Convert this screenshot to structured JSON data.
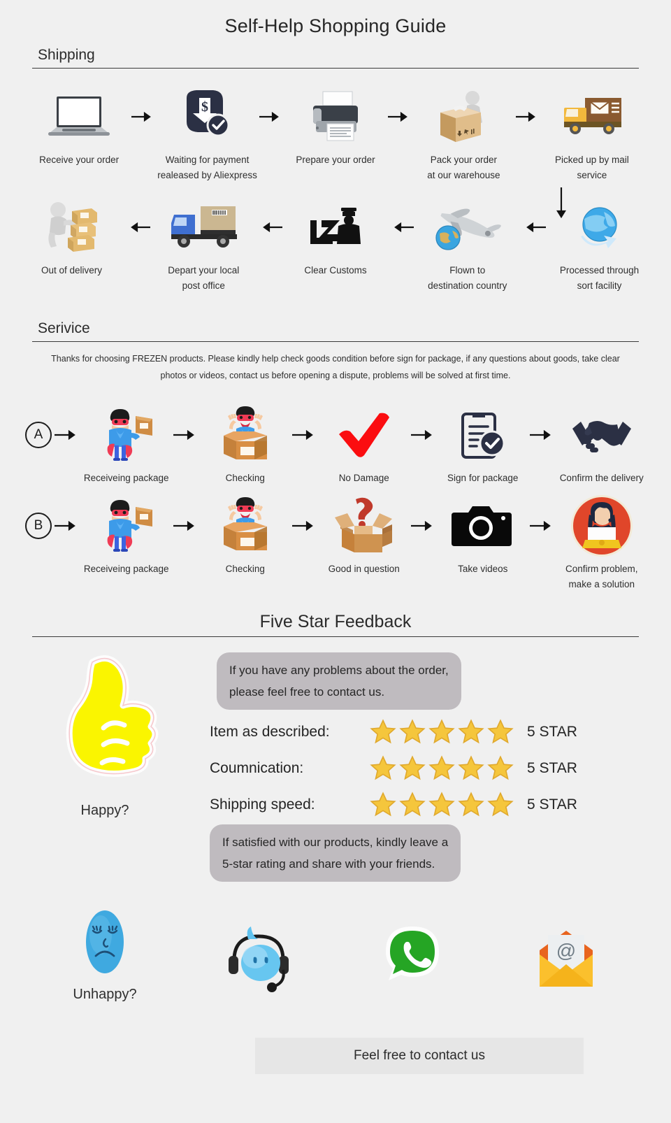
{
  "title": "Self-Help Shopping Guide",
  "sections": {
    "shipping": {
      "heading": "Shipping"
    },
    "service": {
      "heading": "Serivice",
      "note": "Thanks for choosing FREZEN products. Please kindly help check goods condition before sign for package, if any questions about goods, take clear photos or videos, contact us before opening a dispute, problems will be solved at first time."
    },
    "feedback": {
      "heading": "Five Star Feedback"
    }
  },
  "shipping_row_1": [
    {
      "icon": "laptop-icon",
      "label": "Receive your order"
    },
    {
      "icon": "payment-released-icon",
      "label": "Waiting for payment\nrealeased by Aliexpress"
    },
    {
      "icon": "printer-icon",
      "label": "Prepare your order"
    },
    {
      "icon": "packing-worker-icon",
      "label": "Pack your order\nat our warehouse"
    },
    {
      "icon": "mail-truck-icon",
      "label": "Picked up by mail service"
    }
  ],
  "shipping_row_2": [
    {
      "icon": "delivery-worker-icon",
      "label": "Out of delivery"
    },
    {
      "icon": "blue-truck-icon",
      "label": "Depart your local\npost office"
    },
    {
      "icon": "customs-officer-icon",
      "label": "Clear Customs"
    },
    {
      "icon": "airplane-globe-icon",
      "label": "Flown to\ndestination country"
    },
    {
      "icon": "globe-sort-icon",
      "label": "Processed through\nsort facility"
    }
  ],
  "service_row_a": {
    "badge": "A",
    "steps": [
      {
        "icon": "hero-with-box-icon",
        "label": "Receiveing package"
      },
      {
        "icon": "hero-in-box-icon",
        "label": "Checking"
      },
      {
        "icon": "red-check-icon",
        "label": "No Damage"
      },
      {
        "icon": "clipboard-check-icon",
        "label": "Sign for package"
      },
      {
        "icon": "handshake-icon",
        "label": "Confirm the delivery"
      }
    ]
  },
  "service_row_b": {
    "badge": "B",
    "steps": [
      {
        "icon": "hero-with-box-icon",
        "label": "Receiveing package"
      },
      {
        "icon": "hero-in-box-icon",
        "label": "Checking"
      },
      {
        "icon": "question-box-icon",
        "label": "Good in question"
      },
      {
        "icon": "camera-icon",
        "label": "Take videos"
      },
      {
        "icon": "support-agent-icon",
        "label": "Confirm problem,\nmake a solution"
      }
    ]
  },
  "feedback": {
    "thumb_icon": "thumbs-up-icon",
    "thumb_label": "Happy?",
    "bubble_top": "If you have any problems about the order,\nplease feel free to contact us.",
    "bubble_bottom": "If  satisfied with our products, kindly leave a\n5-star rating and share with your friends.",
    "ratings": [
      {
        "label": "Item as described:",
        "stars": 5,
        "value": "5 STAR"
      },
      {
        "label": "Coumnication:",
        "stars": 5,
        "value": "5 STAR"
      },
      {
        "label": "Shipping speed:",
        "stars": 5,
        "value": "5 STAR"
      }
    ]
  },
  "contacts": [
    {
      "icon": "sad-face-icon",
      "label": "Unhappy?"
    },
    {
      "icon": "live-chat-headset-icon",
      "label": ""
    },
    {
      "icon": "whatsapp-icon",
      "label": ""
    },
    {
      "icon": "email-envelope-icon",
      "label": ""
    }
  ],
  "contact_bar": "Feel free to contact us",
  "colors": {
    "background": "#f0f0f0",
    "rule": "#3a3a3a",
    "bubble": "#bfbbbf",
    "star": "#f5c63c",
    "thumb": "#faf500",
    "red_check": "#fb0d10",
    "whatsapp": "#25a524",
    "agent_circle": "#e0462a",
    "bar": "#e6e6e6"
  }
}
